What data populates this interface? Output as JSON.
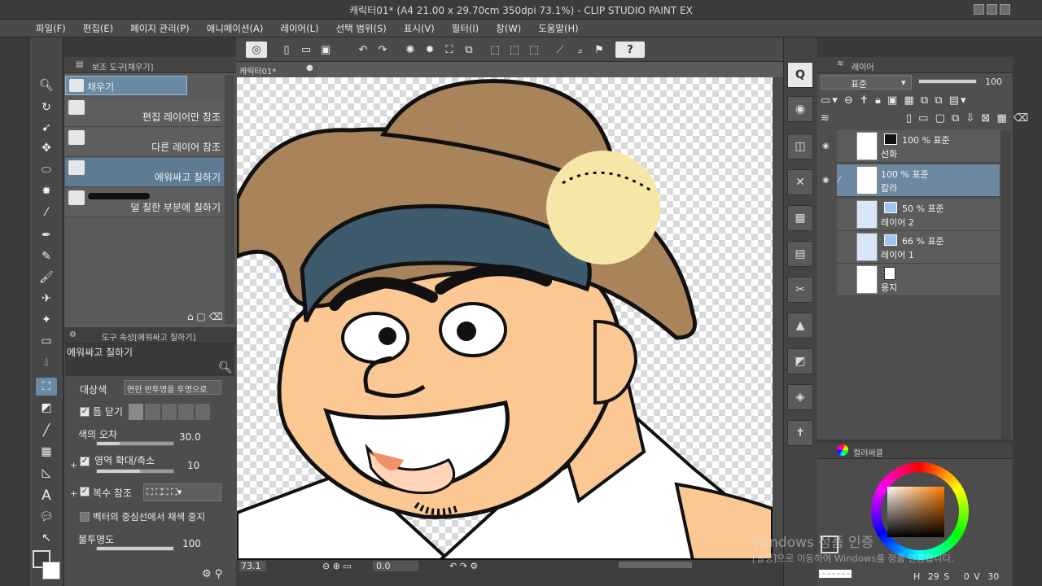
{
  "window": {
    "title": "캐릭터01* (A4 21.00 x 29.70cm 350dpi 73.1%)  - CLIP STUDIO PAINT EX"
  },
  "menu": [
    "파일(F)",
    "편집(E)",
    "페이지 관리(P)",
    "애니메이션(A)",
    "레이어(L)",
    "선택 범위(S)",
    "표시(V)",
    "필터(I)",
    "창(W)",
    "도움말(H)"
  ],
  "subtool": {
    "header": "보조 도구[채우기]",
    "group": "채우기",
    "items": [
      "편집 레이어만 참조",
      "다른 레이어 참조",
      "에워싸고 칠하기",
      "덜 칠한 부분에 칠하기"
    ],
    "selected_index": 2
  },
  "tool_property": {
    "header": "도구 속성[에워싸고 칠하기]",
    "name": "에워싸고 칠하기",
    "target_label": "대상색",
    "target_value": "연한 반투명을 투명으로",
    "gap_label": "틈 닫기",
    "tolerance_label": "색의 오차",
    "tolerance_value": "30.0",
    "expand_label": "영역 확대/축소",
    "expand_value": "10",
    "multi_ref_label": "복수 참조",
    "vector_label": "벡터의 중심선에서 채색 중지",
    "opacity_label": "불투명도",
    "opacity_value": "100"
  },
  "document": {
    "tab": "캐릭터01*"
  },
  "status": {
    "zoom": "73.1",
    "angle": "0.0"
  },
  "layer_panel": {
    "tab": "레이어",
    "blend_mode": "표준",
    "opacity": "100",
    "layers": [
      {
        "mode": "100 % 표준",
        "name": "선화",
        "selected": false
      },
      {
        "mode": "100 % 표준",
        "name": "칼라",
        "selected": true
      },
      {
        "mode": "50 % 표준",
        "name": "레이어 2",
        "selected": false
      },
      {
        "mode": "66 % 표준",
        "name": "레이어 1",
        "selected": false
      },
      {
        "mode": "",
        "name": "용지",
        "selected": false
      }
    ]
  },
  "color_panel": {
    "tab": "컬러써클",
    "h_label": "H",
    "h_value": "29",
    "s_label": "S",
    "s_value": "0",
    "v_label": "V",
    "v_value": "30"
  },
  "watermark": {
    "line1": "Windows 정품 인증",
    "line2": "[설정]으로 이동하여 Windows를 정품 인증합니다."
  },
  "colors": {
    "hat": "#a9835a",
    "band": "#3e5b6e",
    "skin": "#fbc894",
    "pompom": "#f6e7a6",
    "tongue": "#f2906b"
  }
}
